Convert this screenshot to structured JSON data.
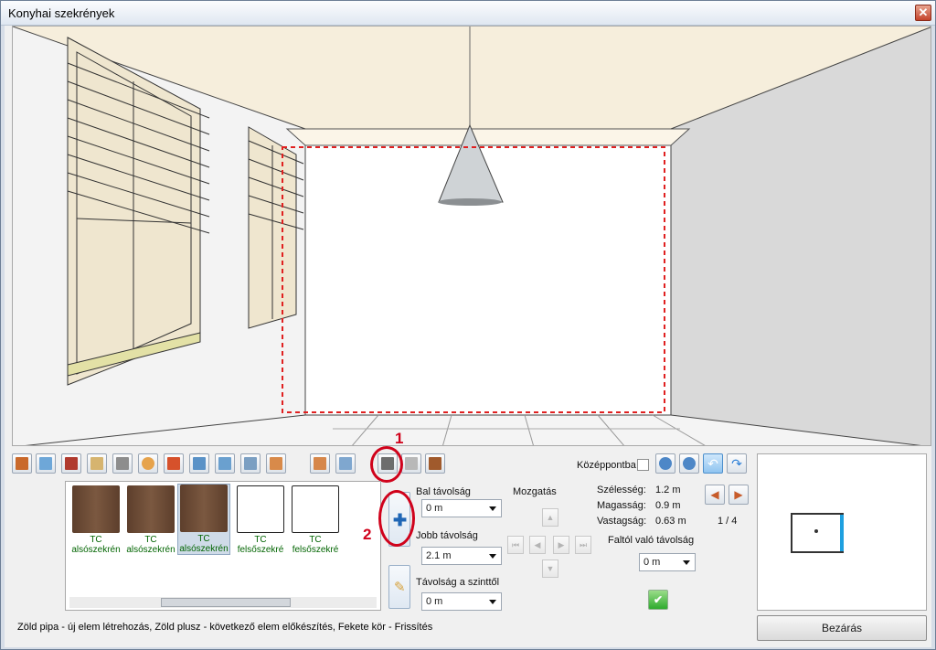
{
  "window": {
    "title": "Konyhai szekrények",
    "close": "✕"
  },
  "toolbar": {
    "center_label": "Középpontba",
    "icons": [
      "door-icon",
      "window-icon",
      "cabinet-icon",
      "panel-icon",
      "sink-icon",
      "lamp-icon",
      "fridge-icon",
      "picture-icon",
      "countertop-icon",
      "countertop-icon-2",
      "countertop-icon-3",
      "shelf-icon",
      "shelf-icon-2",
      "appliance-icon",
      "tap-icon",
      "door-frame-icon"
    ]
  },
  "annotations": {
    "one": "1",
    "two": "2"
  },
  "catalog": [
    {
      "name": "TC",
      "sub": "alsószekrén"
    },
    {
      "name": "TC",
      "sub": "alsószekrén"
    },
    {
      "name": "TC",
      "sub": "alsószekrén"
    },
    {
      "name": "TC",
      "sub": "felsőszekré"
    },
    {
      "name": "TC",
      "sub": "felsőszekré"
    }
  ],
  "form": {
    "bal_label": "Bal távolság",
    "bal_value": "0 m",
    "jobb_label": "Jobb távolság",
    "jobb_value": "2.1 m",
    "szint_label": "Távolság a szinttől",
    "szint_value": "0 m",
    "mozgatas_label": "Mozgatás",
    "szelesseg_label": "Szélesség:",
    "szelesseg_value": "1.2 m",
    "magassag_label": "Magasság:",
    "magassag_value": "0.9 m",
    "vastagsag_label": "Vastagság:",
    "vastagsag_value": "0.63 m",
    "falttol_label": "Faltól való távolság",
    "falttol_value": "0 m",
    "page": "1 / 4"
  },
  "status": "Zöld pipa - új elem létrehozás, Zöld plusz - következő elem előkészítés, Fekete kör - Frissítés",
  "close_button": "Bezárás",
  "colors": {
    "accent": "#2c7fd6",
    "selection_dash": "#e02020",
    "cabinet_wood": "#6b4a36",
    "green_ok": "#2eab2e"
  }
}
